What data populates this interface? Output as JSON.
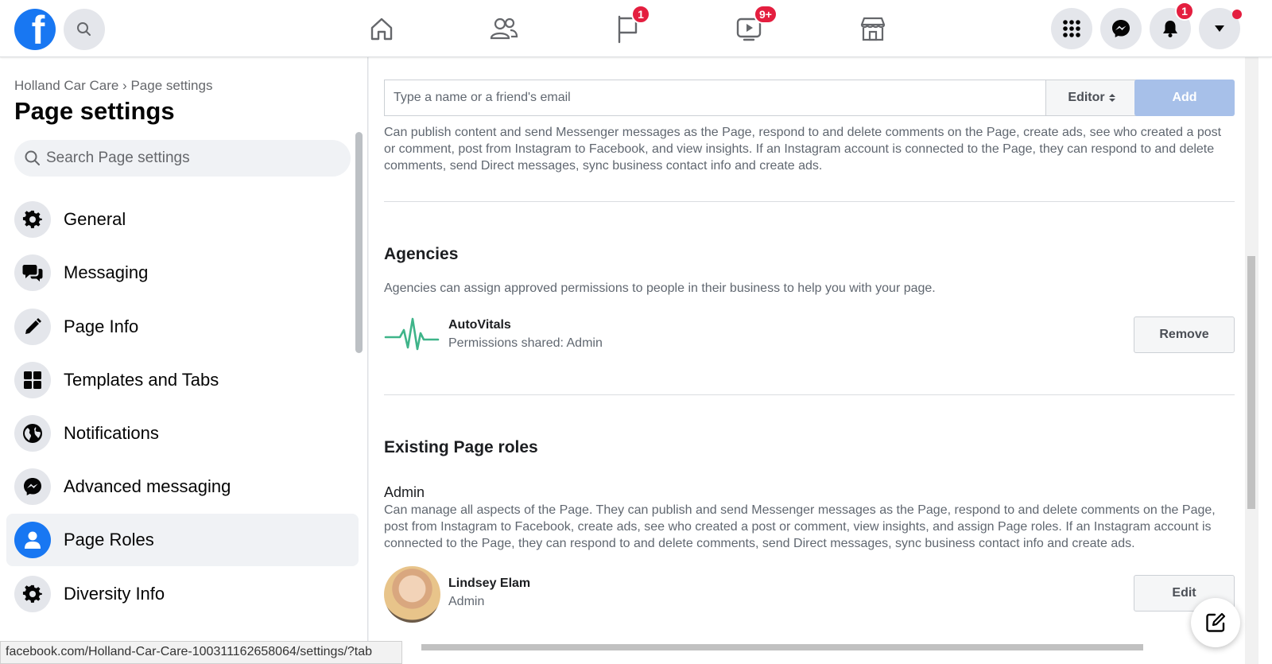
{
  "topbar": {
    "logo_letter": "f",
    "badges": {
      "pages": "1",
      "watch": "9+",
      "notifications": "1"
    }
  },
  "sidebar": {
    "breadcrumb": "Holland Car Care › Page settings",
    "title": "Page settings",
    "search_placeholder": "Search Page settings",
    "items": [
      {
        "label": "General",
        "icon": "gear-icon"
      },
      {
        "label": "Messaging",
        "icon": "chat-bubbles-icon"
      },
      {
        "label": "Page Info",
        "icon": "pencil-icon"
      },
      {
        "label": "Templates and Tabs",
        "icon": "grid-icon"
      },
      {
        "label": "Notifications",
        "icon": "globe-icon"
      },
      {
        "label": "Advanced messaging",
        "icon": "messenger-icon"
      },
      {
        "label": "Page Roles",
        "icon": "person-icon",
        "active": true
      },
      {
        "label": "Diversity Info",
        "icon": "gear-icon"
      }
    ]
  },
  "status_bar": {
    "url": "facebook.com/Holland-Car-Care-100311162658064/settings/?tab"
  },
  "main": {
    "invite": {
      "placeholder": "Type a name or a friend's email",
      "role": "Editor",
      "add_label": "Add",
      "description": "Can publish content and send Messenger messages as the Page, respond to and delete comments on the Page, create ads, see who created a post or comment, post from Instagram to Facebook, and view insights. If an Instagram account is connected to the Page, they can respond to and delete comments, send Direct messages, sync business contact info and create ads."
    },
    "agencies": {
      "title": "Agencies",
      "description": "Agencies can assign approved permissions to people in their business to help you with your page.",
      "agency_name": "AutoVitals",
      "agency_permissions": "Permissions shared: Admin",
      "remove_label": "Remove"
    },
    "existing_roles": {
      "title": "Existing Page roles",
      "role_name": "Admin",
      "role_description": "Can manage all aspects of the Page. They can publish and send Messenger messages as the Page, respond to and delete comments on the Page, post from Instagram to Facebook, create ads, see who created a post or comment, view insights, and assign Page roles. If an Instagram account is connected to the Page, they can respond to and delete comments, send Direct messages, sync business contact info and create ads.",
      "person_name": "Lindsey Elam",
      "person_role": "Admin",
      "edit_label": "Edit"
    }
  },
  "colors": {
    "brand": "#1877f2",
    "badge": "#e41e3f",
    "add_disabled": "#a7c0e9",
    "agency_logo": "#3eb489"
  }
}
